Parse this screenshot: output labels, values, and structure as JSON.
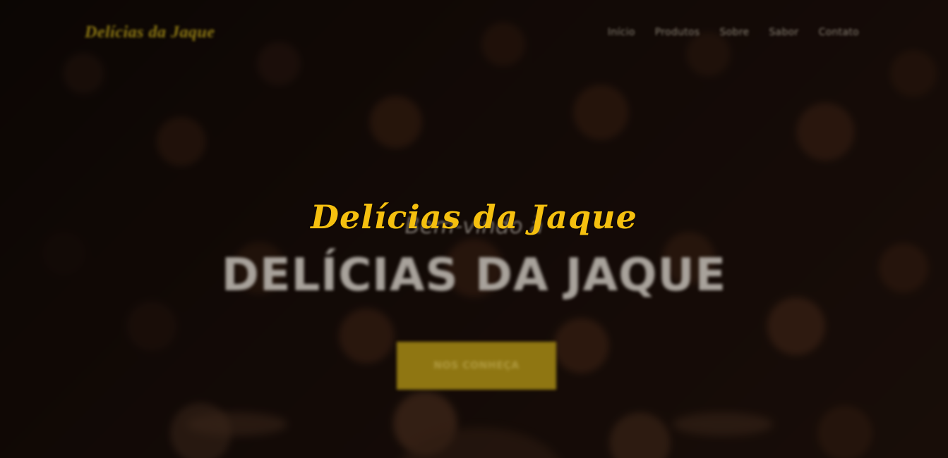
{
  "site": {
    "brand": "Delícias da Jaque",
    "nav": [
      "Início",
      "Produtos",
      "Sobre",
      "Sabor",
      "Contato"
    ]
  },
  "hero": {
    "subtitle": "Bem-vindo à",
    "title": "DELÍCIAS DA JAQUE",
    "button": "NOS CONHEÇA"
  },
  "modal": {
    "title": "Delícias da Jaque"
  },
  "colors": {
    "accent": "#f5c00f",
    "button": "#8f7612",
    "overlay": "rgba(0,0,0,0.58)"
  }
}
